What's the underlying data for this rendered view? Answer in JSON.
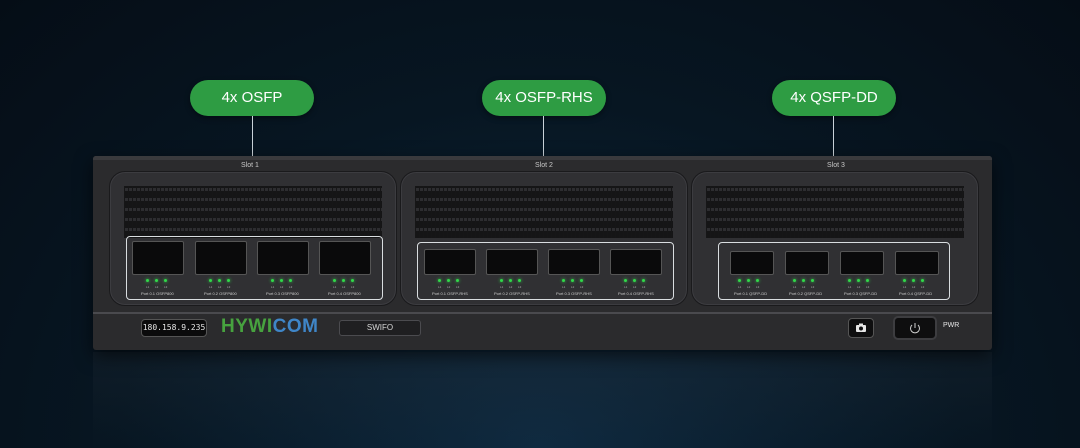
{
  "callouts": [
    {
      "label": "4x OSFP"
    },
    {
      "label": "4x OSFP-RHS"
    },
    {
      "label": "4x QSFP-DD"
    }
  ],
  "slots": [
    {
      "label": "Slot 1",
      "ports": [
        "Port 0.1 OSFP800",
        "Port 0.2 OSFP800",
        "Port 0.3 OSFP800",
        "Port 0.4 OSFP800"
      ],
      "led_labels": [
        "L1",
        "L2",
        "L3"
      ]
    },
    {
      "label": "Slot 2",
      "ports": [
        "Port 0.1 OSFP-RHS",
        "Port 0.2 OSFP-RHS",
        "Port 0.3 OSFP-RHS",
        "Port 0.4 OSFP-RHS"
      ],
      "led_labels": [
        "L1",
        "L2",
        "L3"
      ]
    },
    {
      "label": "Slot 3",
      "ports": [
        "Port 0.1 QSFP-DD",
        "Port 0.2 QSFP-DD",
        "Port 0.3 QSFP-DD",
        "Port 0.4 QSFP-DD"
      ],
      "led_labels": [
        "L1",
        "L2",
        "L3"
      ]
    }
  ],
  "bottom_bar": {
    "ip": "180.158.9.235",
    "brand_part1": "HYWI",
    "brand_part2": "COM",
    "model": "SWIFO",
    "power_label": "PWR"
  },
  "colors": {
    "callout": "#2e9c43",
    "led": "#31d84a",
    "brand_green": "#47a23f",
    "brand_blue": "#3f86c8"
  },
  "icons": {
    "camera": "camera-icon",
    "power": "power-icon"
  }
}
